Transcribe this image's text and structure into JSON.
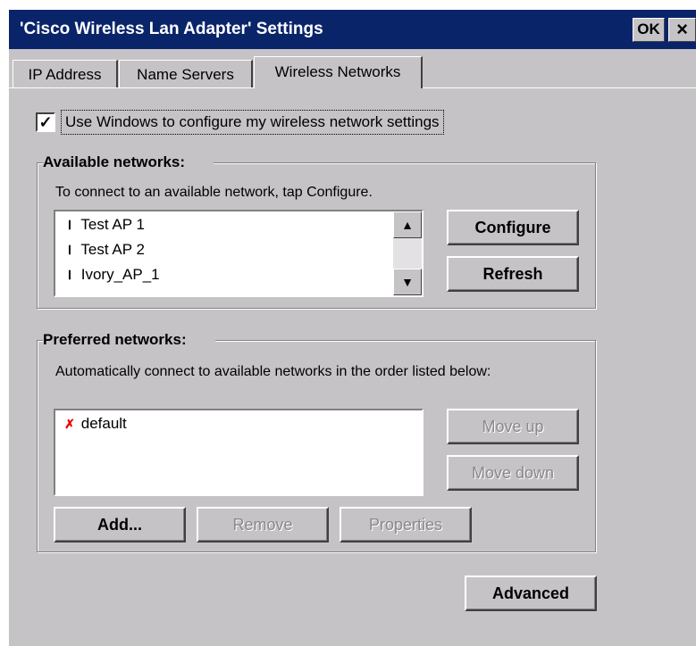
{
  "window": {
    "title": "'Cisco Wireless Lan Adapter' Settings",
    "ok_label": "OK",
    "close_label": "×"
  },
  "tabs": [
    {
      "label": "IP Address",
      "active": false
    },
    {
      "label": "Name Servers",
      "active": false
    },
    {
      "label": "Wireless Networks",
      "active": true
    }
  ],
  "use_windows": {
    "label": "Use Windows to configure my wireless network settings",
    "checked": true,
    "check_glyph": "✓"
  },
  "available": {
    "title": "Available networks:",
    "description": "To connect to an available network, tap Configure.",
    "networks": [
      "Test AP 1",
      "Test AP 2",
      "Ivory_AP_1"
    ],
    "icon": "access-point-icon",
    "scroll_up": "▲",
    "scroll_down": "▼",
    "configure_label": "Configure",
    "refresh_label": "Refresh"
  },
  "preferred": {
    "title": "Preferred networks:",
    "description": "Automatically connect to available networks in the order listed below:",
    "networks": [
      "default"
    ],
    "icon": "unavailable-network-icon",
    "move_up_label": "Move up",
    "move_down_label": "Move down",
    "add_label": "Add...",
    "remove_label": "Remove",
    "properties_label": "Properties"
  },
  "advanced_label": "Advanced",
  "colors": {
    "titlebar": "#0a246a",
    "dialog_face": "#c6c3c6",
    "disabled_text": "#8a888a",
    "unavailable_icon": "#e00000"
  }
}
